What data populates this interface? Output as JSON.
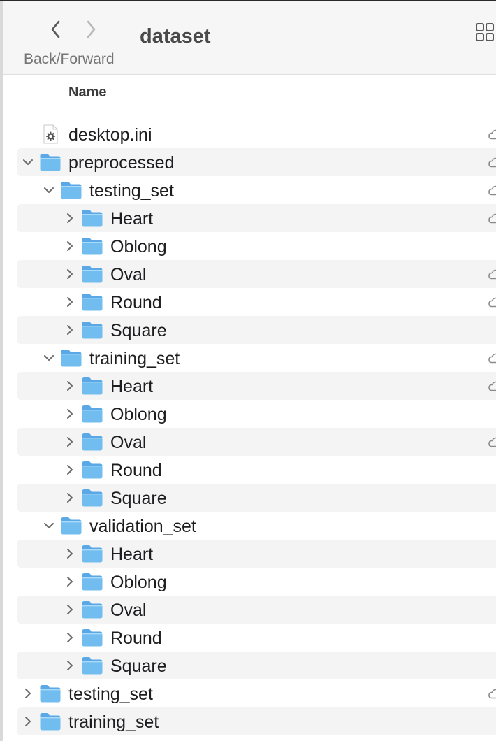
{
  "toolbar": {
    "title": "dataset",
    "nav_label": "Back/Forward",
    "back_icon": "chevron-left-icon",
    "forward_icon": "chevron-right-icon",
    "view_icon": "grid-view-icon"
  },
  "list_header": {
    "name_label": "Name"
  },
  "colors": {
    "folder_body": "#71bdf0",
    "folder_tab": "#5aa9e6",
    "alt_row": "#f4f4f5",
    "text": "#1d1d1f"
  },
  "rows": [
    {
      "label": "desktop.ini",
      "level": 0,
      "kind": "file",
      "disclosure": "none",
      "cloud": true
    },
    {
      "label": "preprocessed",
      "level": 0,
      "kind": "folder",
      "disclosure": "expanded",
      "cloud": true
    },
    {
      "label": "testing_set",
      "level": 1,
      "kind": "folder",
      "disclosure": "expanded",
      "cloud": true
    },
    {
      "label": "Heart",
      "level": 2,
      "kind": "folder",
      "disclosure": "collapsed",
      "cloud": true
    },
    {
      "label": "Oblong",
      "level": 2,
      "kind": "folder",
      "disclosure": "collapsed",
      "cloud": false
    },
    {
      "label": "Oval",
      "level": 2,
      "kind": "folder",
      "disclosure": "collapsed",
      "cloud": true
    },
    {
      "label": "Round",
      "level": 2,
      "kind": "folder",
      "disclosure": "collapsed",
      "cloud": true
    },
    {
      "label": "Square",
      "level": 2,
      "kind": "folder",
      "disclosure": "collapsed",
      "cloud": false
    },
    {
      "label": "training_set",
      "level": 1,
      "kind": "folder",
      "disclosure": "expanded",
      "cloud": true
    },
    {
      "label": "Heart",
      "level": 2,
      "kind": "folder",
      "disclosure": "collapsed",
      "cloud": true
    },
    {
      "label": "Oblong",
      "level": 2,
      "kind": "folder",
      "disclosure": "collapsed",
      "cloud": false
    },
    {
      "label": "Oval",
      "level": 2,
      "kind": "folder",
      "disclosure": "collapsed",
      "cloud": true
    },
    {
      "label": "Round",
      "level": 2,
      "kind": "folder",
      "disclosure": "collapsed",
      "cloud": false
    },
    {
      "label": "Square",
      "level": 2,
      "kind": "folder",
      "disclosure": "collapsed",
      "cloud": false
    },
    {
      "label": "validation_set",
      "level": 1,
      "kind": "folder",
      "disclosure": "expanded",
      "cloud": false
    },
    {
      "label": "Heart",
      "level": 2,
      "kind": "folder",
      "disclosure": "collapsed",
      "cloud": false
    },
    {
      "label": "Oblong",
      "level": 2,
      "kind": "folder",
      "disclosure": "collapsed",
      "cloud": false
    },
    {
      "label": "Oval",
      "level": 2,
      "kind": "folder",
      "disclosure": "collapsed",
      "cloud": false
    },
    {
      "label": "Round",
      "level": 2,
      "kind": "folder",
      "disclosure": "collapsed",
      "cloud": false
    },
    {
      "label": "Square",
      "level": 2,
      "kind": "folder",
      "disclosure": "collapsed",
      "cloud": false
    },
    {
      "label": "testing_set",
      "level": 0,
      "kind": "folder",
      "disclosure": "collapsed",
      "cloud": true
    },
    {
      "label": "training_set",
      "level": 0,
      "kind": "folder",
      "disclosure": "collapsed",
      "cloud": false
    }
  ]
}
